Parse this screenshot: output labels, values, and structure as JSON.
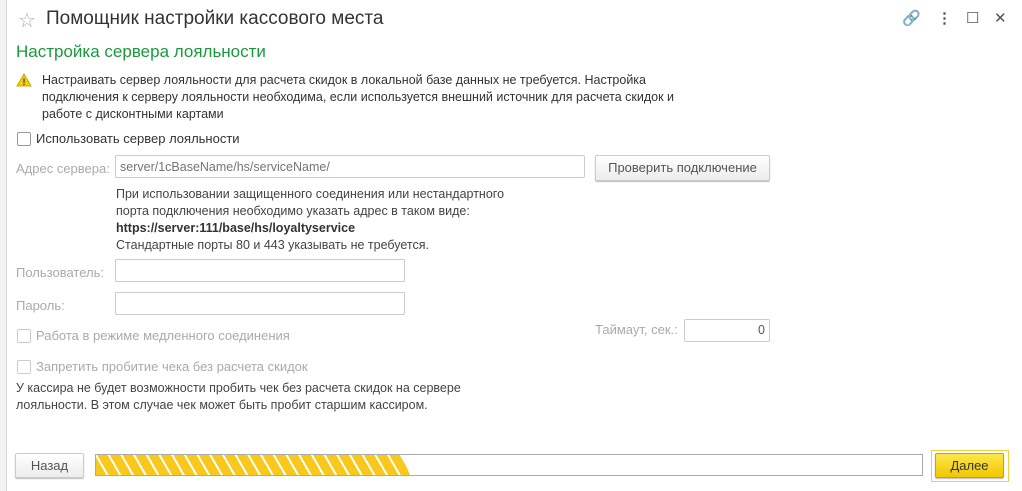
{
  "window": {
    "title": "Помощник настройки кассового места"
  },
  "page": {
    "heading": "Настройка сервера лояльности",
    "warning": "Настраивать сервер лояльности для расчета скидок в локальной базе данных не требуется. Настройка подключения к серверу лояльности необходима, если используется внешний источник для расчета скидок и работе с дисконтными картами"
  },
  "form": {
    "use_server": {
      "label": "Использовать сервер лояльности",
      "checked": false
    },
    "address": {
      "label": "Адрес сервера:",
      "placeholder": "server/1cBaseName/hs/serviceName/",
      "value": ""
    },
    "check_button": "Проверить подключение",
    "hint": {
      "line1": "При использовании защищенного соединения или нестандартного порта подключения необходимо указать адрес в таком виде: ",
      "example": "https://server:111/base/hs/loyaltyservice",
      "line2": "Стандартные порты 80 и 443 указывать не требуется."
    },
    "user": {
      "label": "Пользователь:",
      "value": ""
    },
    "password": {
      "label": "Пароль:",
      "value": ""
    },
    "slow": {
      "label": "Работа в режиме медленного соединения",
      "checked": false
    },
    "timeout": {
      "label": "Таймаут, сек.:",
      "value": "0"
    },
    "forbid": {
      "label": "Запретить пробитие чека без расчета скидок",
      "checked": false
    },
    "forbid_note": "У кассира не будет возможности пробить чек без расчета скидок на сервере лояльности. В этом случае чек может быть пробит старшим кассиром."
  },
  "footer": {
    "back": "Назад",
    "next": "Далее",
    "progress_percent": 38
  },
  "colors": {
    "heading": "#1a9a3c",
    "accent": "#f8c81c"
  }
}
